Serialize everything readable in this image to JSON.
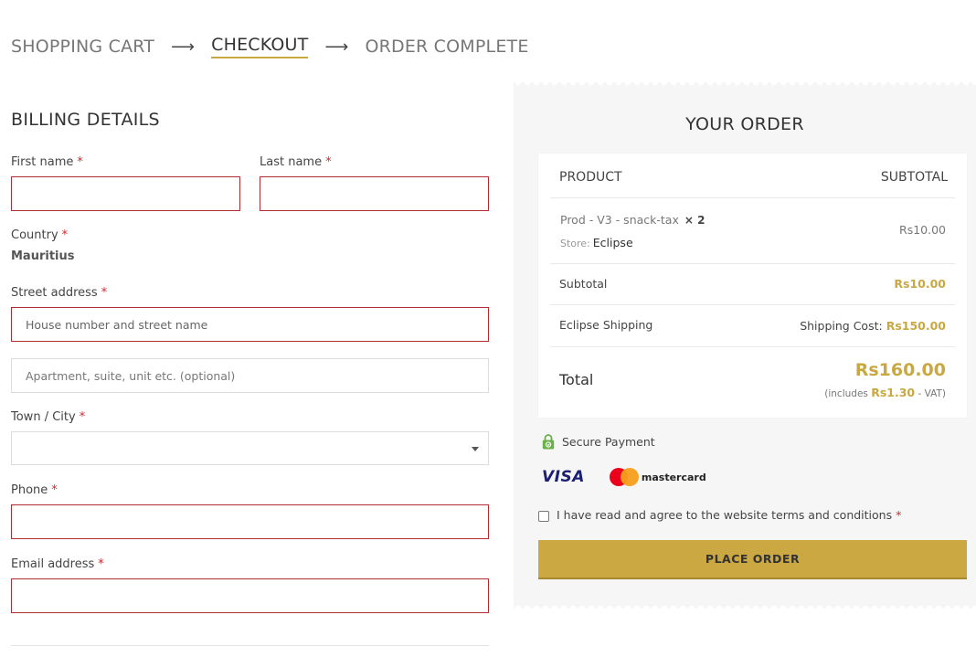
{
  "breadcrumb": {
    "steps": [
      "SHOPPING CART",
      "CHECKOUT",
      "ORDER COMPLETE"
    ],
    "arrow": "⟶",
    "active_index": 1
  },
  "billing": {
    "title": "BILLING DETAILS",
    "required_marker": "*",
    "first_name_label": "First name",
    "last_name_label": "Last name",
    "country_label": "Country",
    "country_value": "Mauritius",
    "street_label": "Street address",
    "street_placeholder": "House number and street name",
    "apartment_placeholder": "Apartment, suite, unit etc. (optional)",
    "city_label": "Town / City",
    "phone_label": "Phone",
    "email_label": "Email address"
  },
  "order": {
    "title": "YOUR ORDER",
    "col_product": "PRODUCT",
    "col_subtotal": "SUBTOTAL",
    "item": {
      "name": "Prod - V3 - snack-tax",
      "qty": "× 2",
      "store_label": "Store:",
      "store_name": "Eclipse",
      "price": "Rs10.00"
    },
    "subtotal_label": "Subtotal",
    "subtotal_value": "Rs10.00",
    "shipping_label": "Eclipse Shipping",
    "shipping_cost_label": "Shipping Cost:",
    "shipping_cost_value": "Rs150.00",
    "total_label": "Total",
    "total_value": "Rs160.00",
    "vat_prefix": "(includes",
    "vat_value": "Rs1.30",
    "vat_suffix": "- VAT)"
  },
  "payment": {
    "secure_label": "Secure Payment",
    "visa_label": "VISA",
    "mastercard_label": "mastercard",
    "terms_label": "I have read and agree to the website terms and conditions",
    "place_order_label": "PLACE ORDER"
  },
  "colors": {
    "accent_gold": "#c9a842",
    "required_red": "#d2282d",
    "invalid_border": "#b52b32"
  }
}
